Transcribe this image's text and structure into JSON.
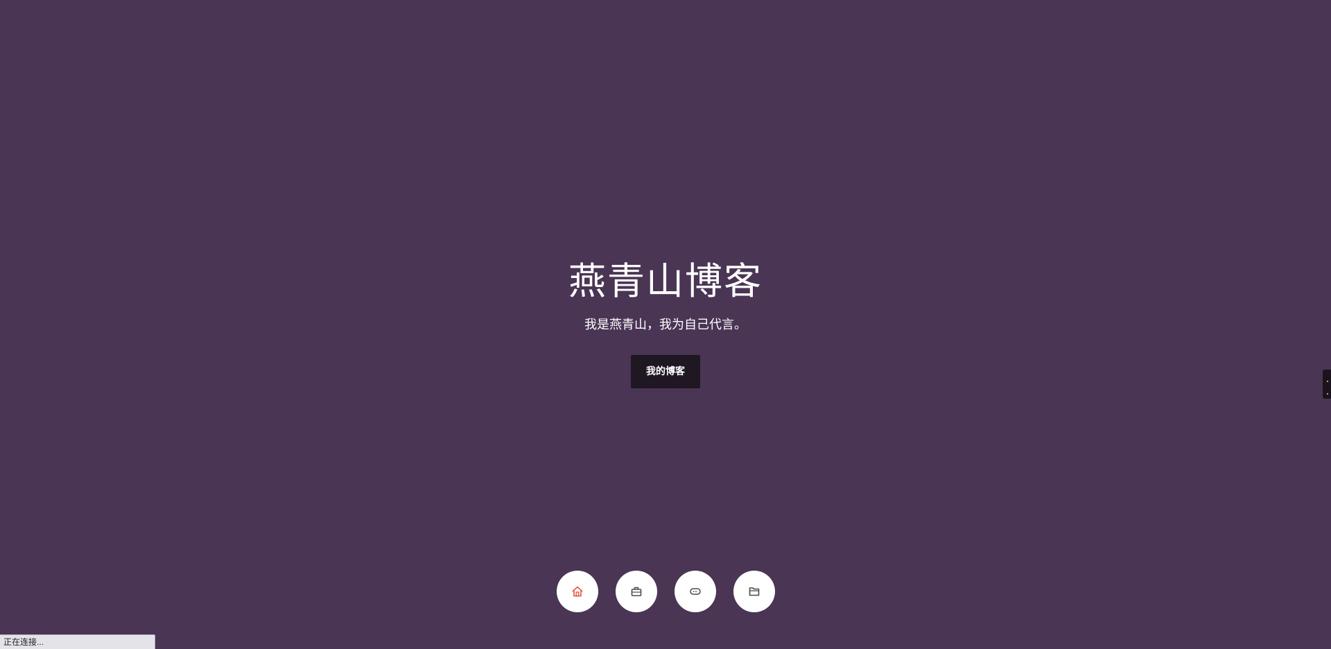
{
  "hero": {
    "title": "燕青山博客",
    "subtitle": "我是燕青山，我为自己代言。",
    "button_label": "我的博客"
  },
  "nav": [
    {
      "name": "home",
      "icon": "home-icon",
      "color": "#e8533f"
    },
    {
      "name": "briefcase",
      "icon": "briefcase-icon",
      "color": "#4a4a4a"
    },
    {
      "name": "chat",
      "icon": "chat-bubble-icon",
      "color": "#4a4a4a"
    },
    {
      "name": "folder",
      "icon": "folder-icon",
      "color": "#4a4a4a"
    }
  ],
  "status_bar": {
    "text": "正在连接..."
  },
  "colors": {
    "background": "#4a3554",
    "button": "#1f1722",
    "accent": "#e8533f"
  }
}
